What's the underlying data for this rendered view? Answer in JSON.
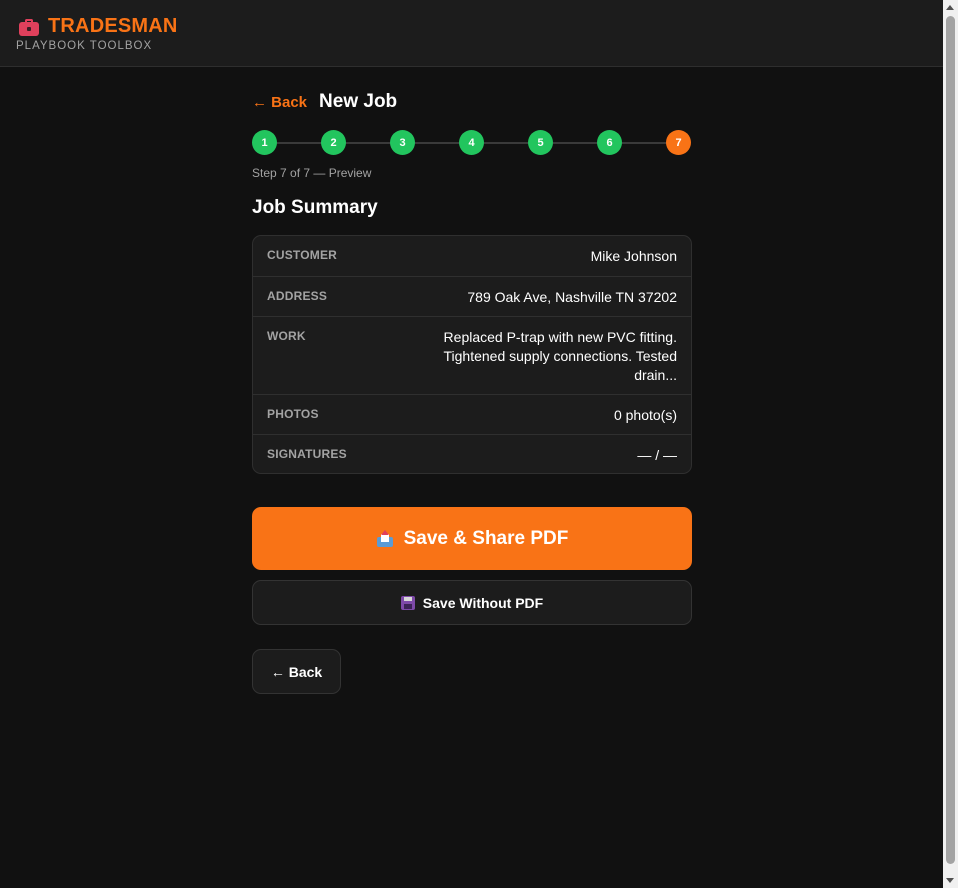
{
  "header": {
    "brand_name": "TRADESMAN",
    "brand_subtitle": "PLAYBOOK TOOLBOX",
    "brand_icon": "toolbox-icon"
  },
  "page": {
    "back_label": "← Back",
    "title": "New Job"
  },
  "stepper": {
    "steps": [
      "1",
      "2",
      "3",
      "4",
      "5",
      "6",
      "7"
    ],
    "current_step": 7,
    "caption": "Step 7 of 7 — Preview"
  },
  "summary": {
    "title": "Job Summary",
    "rows": [
      {
        "label": "CUSTOMER",
        "value": "Mike Johnson"
      },
      {
        "label": "ADDRESS",
        "value": "789 Oak Ave, Nashville TN 37202"
      },
      {
        "label": "WORK",
        "value": "Replaced P-trap with new PVC fitting. Tightened supply connections. Tested drain..."
      },
      {
        "label": "PHOTOS",
        "value": "0 photo(s)"
      },
      {
        "label": "SIGNATURES",
        "value": "— / —"
      }
    ]
  },
  "actions": {
    "save_share_label": "Save & Share PDF",
    "save_share_icon": "outbox-tray-icon",
    "save_without_label": "Save Without PDF",
    "save_without_icon": "floppy-disk-icon",
    "back_label": "← Back"
  },
  "colors": {
    "accent": "#f97316",
    "step_complete": "#22c55e",
    "background": "#111111",
    "surface": "#1c1c1c"
  }
}
